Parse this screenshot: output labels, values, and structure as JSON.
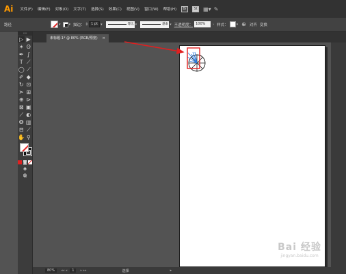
{
  "app": {
    "logo": "Ai"
  },
  "menubar": {
    "items": [
      "文件(F)",
      "编辑(E)",
      "对象(O)",
      "文字(T)",
      "选择(S)",
      "效果(C)",
      "视图(V)",
      "窗口(W)",
      "帮助(H)"
    ],
    "icons": [
      {
        "name": "bridge-icon",
        "label": "Br"
      },
      {
        "name": "stock-icon",
        "label": "St"
      },
      {
        "name": "workspace-layout-icon",
        "label": ""
      },
      {
        "name": "gpu-performance-icon",
        "label": ""
      }
    ]
  },
  "controlbar": {
    "selection_label": "路径",
    "stroke_label": "描边：",
    "stroke_weight": "1 pt",
    "variable_width_label": "等比",
    "brush_label": "基本",
    "opacity_label": "不透明度：",
    "opacity_value": "100%",
    "style_label": "样式：",
    "align_label": "对齐",
    "transform_label": "变换"
  },
  "document": {
    "tab_label": "未标题-1* @ 80% (RGB/预览)",
    "close_glyph": "×"
  },
  "statusbar": {
    "zoom": "80%",
    "artboard_number": "1",
    "mode": "选择"
  },
  "watermark": {
    "main": "Bai 经验",
    "sub": "jingyan.baidu.com"
  },
  "annotation": {
    "arrow_color": "#e02020",
    "highlight_color": "#e02020"
  },
  "colors": {
    "accent_logo": "#ff9a00",
    "menubar": "#323232",
    "workspace": "#535353"
  }
}
